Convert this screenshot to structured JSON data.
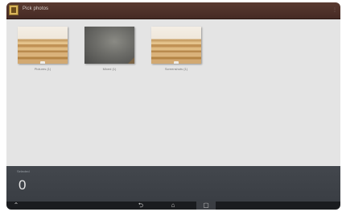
{
  "app": {
    "title": "Pick photos",
    "icon": "gallery-app-icon",
    "menu_glyph": "⋮"
  },
  "albums": [
    {
      "label": "Pictures (1)",
      "thumb": "wood"
    },
    {
      "label": "Mixed (1)",
      "thumb": "dark"
    },
    {
      "label": "Screenshots (1)",
      "thumb": "wood"
    }
  ],
  "selection": {
    "label": "Selected",
    "count": "0"
  },
  "navbar": {
    "back_glyph": "⮌",
    "home_glyph": "⌂",
    "recents_glyph": "▢",
    "up_glyph": "⌃"
  }
}
